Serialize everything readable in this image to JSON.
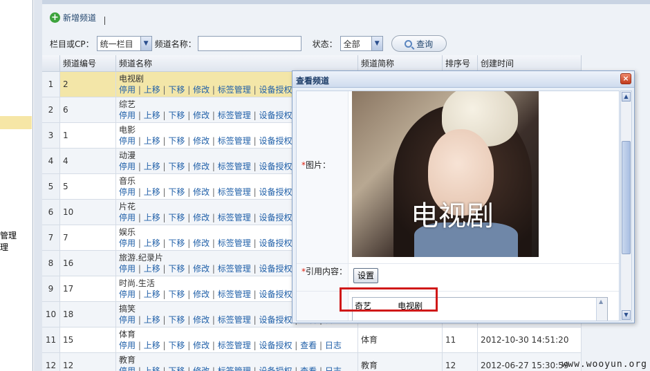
{
  "leftnav": {
    "text1": "管理",
    "text2": "理"
  },
  "toolbar": {
    "add_label": "新增频道",
    "filter_column_label": "栏目或CP：",
    "filter_column_value": "统一栏目",
    "channel_name_label": "频道名称：",
    "channel_name_value": "",
    "status_label": "状态：",
    "status_value": "全部",
    "query_label": "查询"
  },
  "table": {
    "columns": [
      "频道编号",
      "频道名称",
      "频道简称",
      "排序号",
      "创建时间"
    ],
    "ops_visible": [
      "停用",
      "上移",
      "下移",
      "修改",
      "标签管理",
      "设备授权",
      "查看",
      "日志"
    ],
    "rows": [
      {
        "num": "1",
        "code": "2",
        "name": "电视剧",
        "short": "",
        "order": "",
        "time": ""
      },
      {
        "num": "2",
        "code": "6",
        "name": "综艺",
        "short": "",
        "order": "",
        "time": ""
      },
      {
        "num": "3",
        "code": "1",
        "name": "电影",
        "short": "",
        "order": "",
        "time": ""
      },
      {
        "num": "4",
        "code": "4",
        "name": "动漫",
        "short": "",
        "order": "",
        "time": ""
      },
      {
        "num": "5",
        "code": "5",
        "name": "音乐",
        "short": "",
        "order": "",
        "time": ""
      },
      {
        "num": "6",
        "code": "10",
        "name": "片花",
        "short": "",
        "order": "",
        "time": ""
      },
      {
        "num": "7",
        "code": "7",
        "name": "娱乐",
        "short": "",
        "order": "",
        "time": ""
      },
      {
        "num": "8",
        "code": "16",
        "name": "旅游.纪录片",
        "short": "",
        "order": "",
        "time": ""
      },
      {
        "num": "9",
        "code": "17",
        "name": "时尚.生活",
        "short": "",
        "order": "",
        "time": ""
      },
      {
        "num": "10",
        "code": "18",
        "name": "搞笑",
        "short": "",
        "order": "",
        "time": ""
      },
      {
        "num": "11",
        "code": "15",
        "name": "体育",
        "short": "体育",
        "order": "11",
        "time": "2012-10-30 14:51:20"
      },
      {
        "num": "12",
        "code": "12",
        "name": "教育",
        "short": "教育",
        "order": "12",
        "time": "2012-06-27 15:30:59"
      }
    ]
  },
  "dialog": {
    "title": "查看频道",
    "image_label": "图片：",
    "image_caption": "电视剧",
    "ref_label": "引用内容：",
    "set_button": "设置",
    "ref_text": "奇艺          电视剧"
  },
  "watermark": "www.wooyun.org"
}
